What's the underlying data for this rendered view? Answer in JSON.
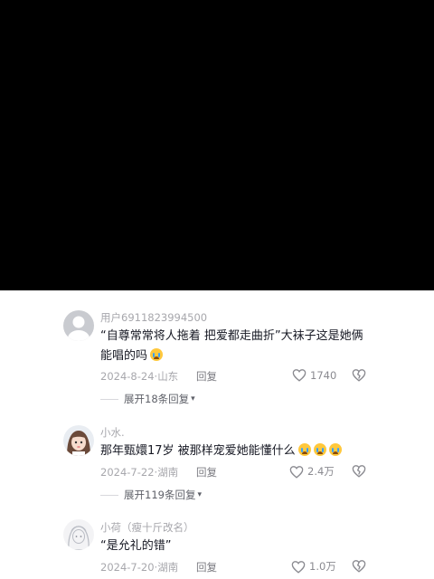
{
  "comments": [
    {
      "username": "用户6911823994500",
      "text": "“自尊常常将人拖着 把爱都走曲折”大袜子这是她俩能唱的吗",
      "emoji_count": 1,
      "date": "2024-8-24",
      "location": "山东",
      "reply_label": "回复",
      "likes": "1740",
      "expand_label": "展开18条回复"
    },
    {
      "username": "小水.",
      "text": "那年甄嬛17岁 被那样宠爱她能懂什么",
      "emoji_count": 3,
      "date": "2024-7-22",
      "location": "湖南",
      "reply_label": "回复",
      "likes": "2.4万",
      "expand_label": "展开119条回复"
    },
    {
      "username": "小荷（瘦十斤改名）",
      "text": "“是允礼的错”",
      "emoji_count": 0,
      "date": "2024-7-20",
      "location": "湖南",
      "reply_label": "回复",
      "likes": "1.0万"
    }
  ],
  "icons": {
    "like": "heart-outline-icon",
    "dislike": "broken-heart-icon",
    "expand": "chevron-down-icon",
    "emoji": "crying-face-emoji"
  },
  "colors": {
    "video_background": "#000000",
    "sheet_background": "#ffffff",
    "primary_text": "#161823",
    "secondary_text": "#a7a7ac"
  }
}
